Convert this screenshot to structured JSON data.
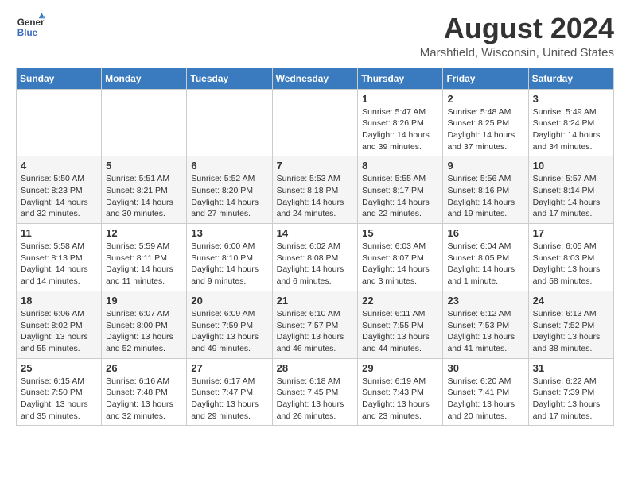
{
  "header": {
    "logo_general": "General",
    "logo_blue": "Blue",
    "month_title": "August 2024",
    "location": "Marshfield, Wisconsin, United States"
  },
  "days_of_week": [
    "Sunday",
    "Monday",
    "Tuesday",
    "Wednesday",
    "Thursday",
    "Friday",
    "Saturday"
  ],
  "weeks": [
    [
      {
        "day": "",
        "info": ""
      },
      {
        "day": "",
        "info": ""
      },
      {
        "day": "",
        "info": ""
      },
      {
        "day": "",
        "info": ""
      },
      {
        "day": "1",
        "info": "Sunrise: 5:47 AM\nSunset: 8:26 PM\nDaylight: 14 hours\nand 39 minutes."
      },
      {
        "day": "2",
        "info": "Sunrise: 5:48 AM\nSunset: 8:25 PM\nDaylight: 14 hours\nand 37 minutes."
      },
      {
        "day": "3",
        "info": "Sunrise: 5:49 AM\nSunset: 8:24 PM\nDaylight: 14 hours\nand 34 minutes."
      }
    ],
    [
      {
        "day": "4",
        "info": "Sunrise: 5:50 AM\nSunset: 8:23 PM\nDaylight: 14 hours\nand 32 minutes."
      },
      {
        "day": "5",
        "info": "Sunrise: 5:51 AM\nSunset: 8:21 PM\nDaylight: 14 hours\nand 30 minutes."
      },
      {
        "day": "6",
        "info": "Sunrise: 5:52 AM\nSunset: 8:20 PM\nDaylight: 14 hours\nand 27 minutes."
      },
      {
        "day": "7",
        "info": "Sunrise: 5:53 AM\nSunset: 8:18 PM\nDaylight: 14 hours\nand 24 minutes."
      },
      {
        "day": "8",
        "info": "Sunrise: 5:55 AM\nSunset: 8:17 PM\nDaylight: 14 hours\nand 22 minutes."
      },
      {
        "day": "9",
        "info": "Sunrise: 5:56 AM\nSunset: 8:16 PM\nDaylight: 14 hours\nand 19 minutes."
      },
      {
        "day": "10",
        "info": "Sunrise: 5:57 AM\nSunset: 8:14 PM\nDaylight: 14 hours\nand 17 minutes."
      }
    ],
    [
      {
        "day": "11",
        "info": "Sunrise: 5:58 AM\nSunset: 8:13 PM\nDaylight: 14 hours\nand 14 minutes."
      },
      {
        "day": "12",
        "info": "Sunrise: 5:59 AM\nSunset: 8:11 PM\nDaylight: 14 hours\nand 11 minutes."
      },
      {
        "day": "13",
        "info": "Sunrise: 6:00 AM\nSunset: 8:10 PM\nDaylight: 14 hours\nand 9 minutes."
      },
      {
        "day": "14",
        "info": "Sunrise: 6:02 AM\nSunset: 8:08 PM\nDaylight: 14 hours\nand 6 minutes."
      },
      {
        "day": "15",
        "info": "Sunrise: 6:03 AM\nSunset: 8:07 PM\nDaylight: 14 hours\nand 3 minutes."
      },
      {
        "day": "16",
        "info": "Sunrise: 6:04 AM\nSunset: 8:05 PM\nDaylight: 14 hours\nand 1 minute."
      },
      {
        "day": "17",
        "info": "Sunrise: 6:05 AM\nSunset: 8:03 PM\nDaylight: 13 hours\nand 58 minutes."
      }
    ],
    [
      {
        "day": "18",
        "info": "Sunrise: 6:06 AM\nSunset: 8:02 PM\nDaylight: 13 hours\nand 55 minutes."
      },
      {
        "day": "19",
        "info": "Sunrise: 6:07 AM\nSunset: 8:00 PM\nDaylight: 13 hours\nand 52 minutes."
      },
      {
        "day": "20",
        "info": "Sunrise: 6:09 AM\nSunset: 7:59 PM\nDaylight: 13 hours\nand 49 minutes."
      },
      {
        "day": "21",
        "info": "Sunrise: 6:10 AM\nSunset: 7:57 PM\nDaylight: 13 hours\nand 46 minutes."
      },
      {
        "day": "22",
        "info": "Sunrise: 6:11 AM\nSunset: 7:55 PM\nDaylight: 13 hours\nand 44 minutes."
      },
      {
        "day": "23",
        "info": "Sunrise: 6:12 AM\nSunset: 7:53 PM\nDaylight: 13 hours\nand 41 minutes."
      },
      {
        "day": "24",
        "info": "Sunrise: 6:13 AM\nSunset: 7:52 PM\nDaylight: 13 hours\nand 38 minutes."
      }
    ],
    [
      {
        "day": "25",
        "info": "Sunrise: 6:15 AM\nSunset: 7:50 PM\nDaylight: 13 hours\nand 35 minutes."
      },
      {
        "day": "26",
        "info": "Sunrise: 6:16 AM\nSunset: 7:48 PM\nDaylight: 13 hours\nand 32 minutes."
      },
      {
        "day": "27",
        "info": "Sunrise: 6:17 AM\nSunset: 7:47 PM\nDaylight: 13 hours\nand 29 minutes."
      },
      {
        "day": "28",
        "info": "Sunrise: 6:18 AM\nSunset: 7:45 PM\nDaylight: 13 hours\nand 26 minutes."
      },
      {
        "day": "29",
        "info": "Sunrise: 6:19 AM\nSunset: 7:43 PM\nDaylight: 13 hours\nand 23 minutes."
      },
      {
        "day": "30",
        "info": "Sunrise: 6:20 AM\nSunset: 7:41 PM\nDaylight: 13 hours\nand 20 minutes."
      },
      {
        "day": "31",
        "info": "Sunrise: 6:22 AM\nSunset: 7:39 PM\nDaylight: 13 hours\nand 17 minutes."
      }
    ]
  ]
}
